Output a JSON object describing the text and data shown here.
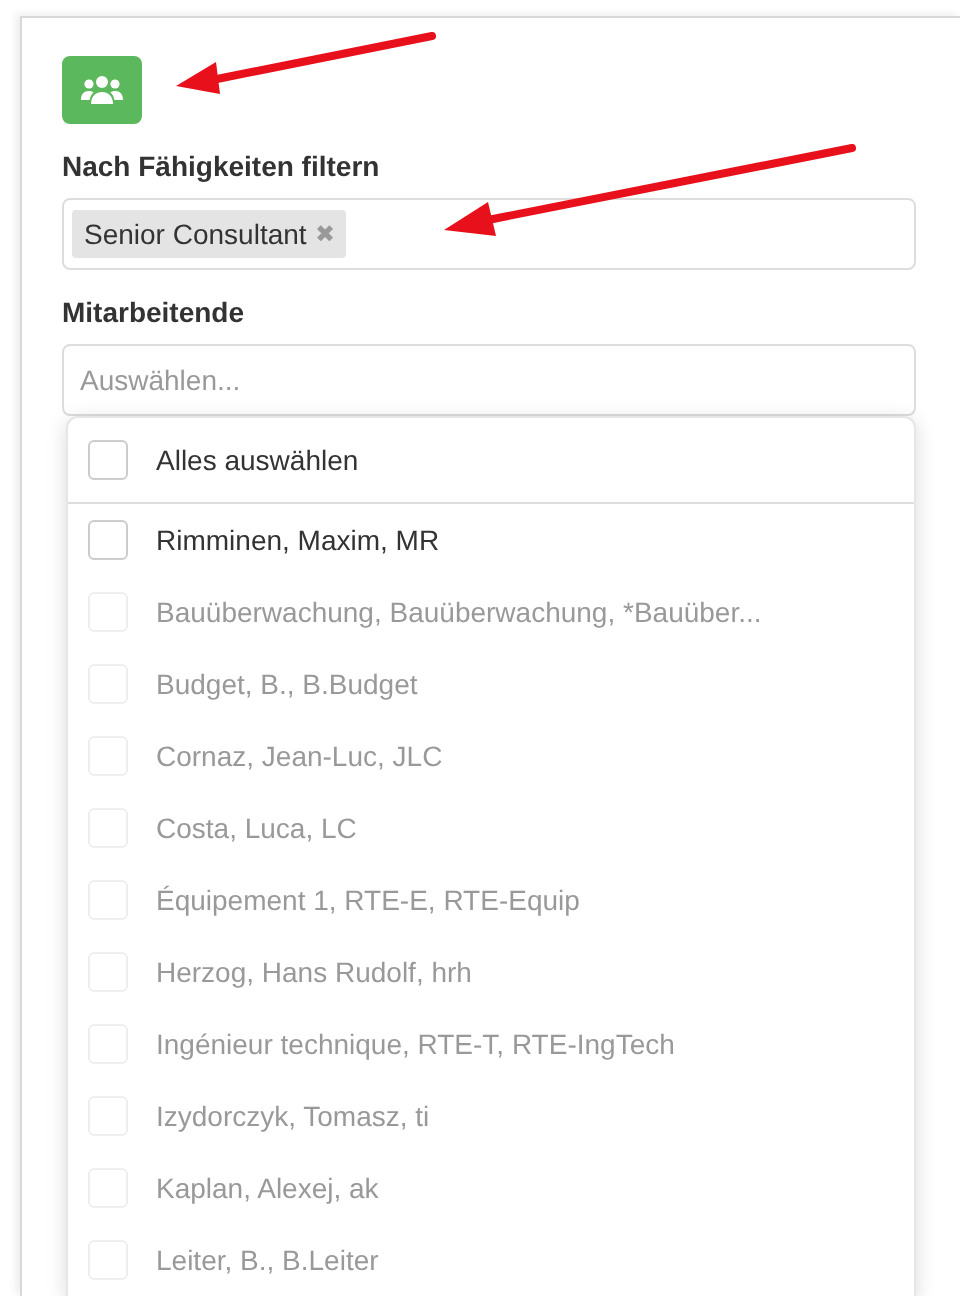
{
  "skills_filter": {
    "label": "Nach Fähigkeiten filtern",
    "tags": [
      {
        "label": "Senior Consultant",
        "remove": "✖"
      }
    ]
  },
  "employees": {
    "label": "Mitarbeitende",
    "placeholder": "Auswählen...",
    "select_all": {
      "label": "Alles auswählen",
      "checked": false
    },
    "options": [
      {
        "label": "Rimminen, Maxim, MR",
        "checked": false,
        "disabled": false
      },
      {
        "label": "Bauüberwachung, Bauüberwachung, *Bauüber...",
        "checked": false,
        "disabled": true
      },
      {
        "label": "Budget, B., B.Budget",
        "checked": false,
        "disabled": true
      },
      {
        "label": "Cornaz, Jean-Luc, JLC",
        "checked": false,
        "disabled": true
      },
      {
        "label": "Costa, Luca, LC",
        "checked": false,
        "disabled": true
      },
      {
        "label": "Équipement 1, RTE-E, RTE-Equip",
        "checked": false,
        "disabled": true
      },
      {
        "label": "Herzog, Hans Rudolf, hrh",
        "checked": false,
        "disabled": true
      },
      {
        "label": "Ingénieur technique, RTE-T, RTE-IngTech",
        "checked": false,
        "disabled": true
      },
      {
        "label": "Izydorczyk, Tomasz, ti",
        "checked": false,
        "disabled": true
      },
      {
        "label": "Kaplan, Alexej, ak",
        "checked": false,
        "disabled": true
      },
      {
        "label": "Leiter, B., B.Leiter",
        "checked": false,
        "disabled": true
      }
    ]
  }
}
